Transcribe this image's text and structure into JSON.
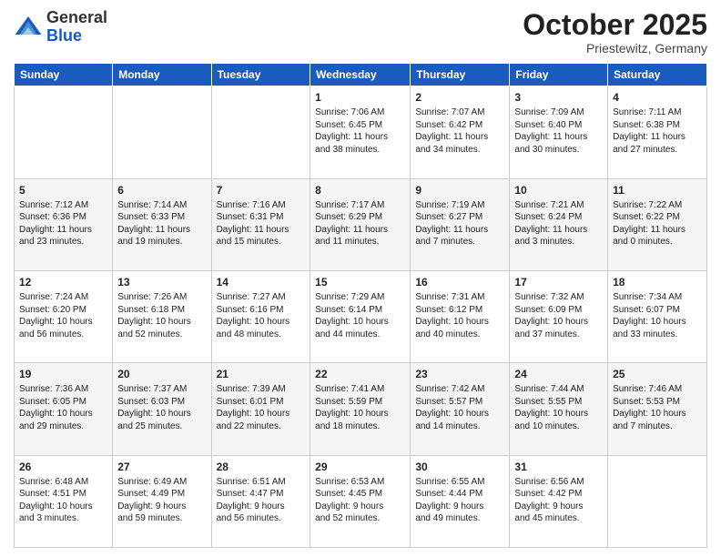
{
  "header": {
    "logo_general": "General",
    "logo_blue": "Blue",
    "title": "October 2025",
    "location": "Priestewitz, Germany"
  },
  "days_of_week": [
    "Sunday",
    "Monday",
    "Tuesday",
    "Wednesday",
    "Thursday",
    "Friday",
    "Saturday"
  ],
  "weeks": [
    [
      {
        "day": "",
        "info": ""
      },
      {
        "day": "",
        "info": ""
      },
      {
        "day": "",
        "info": ""
      },
      {
        "day": "1",
        "info": "Sunrise: 7:06 AM\nSunset: 6:45 PM\nDaylight: 11 hours\nand 38 minutes."
      },
      {
        "day": "2",
        "info": "Sunrise: 7:07 AM\nSunset: 6:42 PM\nDaylight: 11 hours\nand 34 minutes."
      },
      {
        "day": "3",
        "info": "Sunrise: 7:09 AM\nSunset: 6:40 PM\nDaylight: 11 hours\nand 30 minutes."
      },
      {
        "day": "4",
        "info": "Sunrise: 7:11 AM\nSunset: 6:38 PM\nDaylight: 11 hours\nand 27 minutes."
      }
    ],
    [
      {
        "day": "5",
        "info": "Sunrise: 7:12 AM\nSunset: 6:36 PM\nDaylight: 11 hours\nand 23 minutes."
      },
      {
        "day": "6",
        "info": "Sunrise: 7:14 AM\nSunset: 6:33 PM\nDaylight: 11 hours\nand 19 minutes."
      },
      {
        "day": "7",
        "info": "Sunrise: 7:16 AM\nSunset: 6:31 PM\nDaylight: 11 hours\nand 15 minutes."
      },
      {
        "day": "8",
        "info": "Sunrise: 7:17 AM\nSunset: 6:29 PM\nDaylight: 11 hours\nand 11 minutes."
      },
      {
        "day": "9",
        "info": "Sunrise: 7:19 AM\nSunset: 6:27 PM\nDaylight: 11 hours\nand 7 minutes."
      },
      {
        "day": "10",
        "info": "Sunrise: 7:21 AM\nSunset: 6:24 PM\nDaylight: 11 hours\nand 3 minutes."
      },
      {
        "day": "11",
        "info": "Sunrise: 7:22 AM\nSunset: 6:22 PM\nDaylight: 11 hours\nand 0 minutes."
      }
    ],
    [
      {
        "day": "12",
        "info": "Sunrise: 7:24 AM\nSunset: 6:20 PM\nDaylight: 10 hours\nand 56 minutes."
      },
      {
        "day": "13",
        "info": "Sunrise: 7:26 AM\nSunset: 6:18 PM\nDaylight: 10 hours\nand 52 minutes."
      },
      {
        "day": "14",
        "info": "Sunrise: 7:27 AM\nSunset: 6:16 PM\nDaylight: 10 hours\nand 48 minutes."
      },
      {
        "day": "15",
        "info": "Sunrise: 7:29 AM\nSunset: 6:14 PM\nDaylight: 10 hours\nand 44 minutes."
      },
      {
        "day": "16",
        "info": "Sunrise: 7:31 AM\nSunset: 6:12 PM\nDaylight: 10 hours\nand 40 minutes."
      },
      {
        "day": "17",
        "info": "Sunrise: 7:32 AM\nSunset: 6:09 PM\nDaylight: 10 hours\nand 37 minutes."
      },
      {
        "day": "18",
        "info": "Sunrise: 7:34 AM\nSunset: 6:07 PM\nDaylight: 10 hours\nand 33 minutes."
      }
    ],
    [
      {
        "day": "19",
        "info": "Sunrise: 7:36 AM\nSunset: 6:05 PM\nDaylight: 10 hours\nand 29 minutes."
      },
      {
        "day": "20",
        "info": "Sunrise: 7:37 AM\nSunset: 6:03 PM\nDaylight: 10 hours\nand 25 minutes."
      },
      {
        "day": "21",
        "info": "Sunrise: 7:39 AM\nSunset: 6:01 PM\nDaylight: 10 hours\nand 22 minutes."
      },
      {
        "day": "22",
        "info": "Sunrise: 7:41 AM\nSunset: 5:59 PM\nDaylight: 10 hours\nand 18 minutes."
      },
      {
        "day": "23",
        "info": "Sunrise: 7:42 AM\nSunset: 5:57 PM\nDaylight: 10 hours\nand 14 minutes."
      },
      {
        "day": "24",
        "info": "Sunrise: 7:44 AM\nSunset: 5:55 PM\nDaylight: 10 hours\nand 10 minutes."
      },
      {
        "day": "25",
        "info": "Sunrise: 7:46 AM\nSunset: 5:53 PM\nDaylight: 10 hours\nand 7 minutes."
      }
    ],
    [
      {
        "day": "26",
        "info": "Sunrise: 6:48 AM\nSunset: 4:51 PM\nDaylight: 10 hours\nand 3 minutes."
      },
      {
        "day": "27",
        "info": "Sunrise: 6:49 AM\nSunset: 4:49 PM\nDaylight: 9 hours\nand 59 minutes."
      },
      {
        "day": "28",
        "info": "Sunrise: 6:51 AM\nSunset: 4:47 PM\nDaylight: 9 hours\nand 56 minutes."
      },
      {
        "day": "29",
        "info": "Sunrise: 6:53 AM\nSunset: 4:45 PM\nDaylight: 9 hours\nand 52 minutes."
      },
      {
        "day": "30",
        "info": "Sunrise: 6:55 AM\nSunset: 4:44 PM\nDaylight: 9 hours\nand 49 minutes."
      },
      {
        "day": "31",
        "info": "Sunrise: 6:56 AM\nSunset: 4:42 PM\nDaylight: 9 hours\nand 45 minutes."
      },
      {
        "day": "",
        "info": ""
      }
    ]
  ]
}
